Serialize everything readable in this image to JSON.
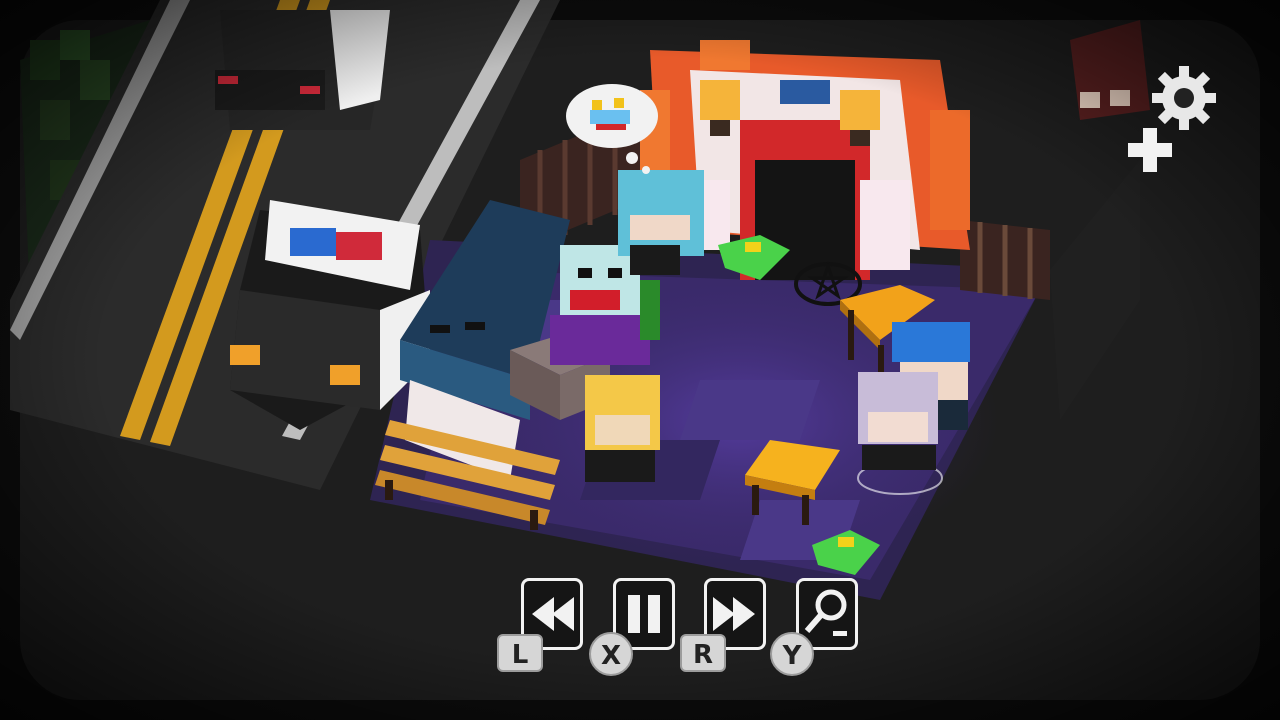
{
  "hud": {
    "controls": [
      {
        "id": "rewind",
        "icon": "rewind-icon",
        "key": "L",
        "key_shape": "square"
      },
      {
        "id": "pause",
        "icon": "pause-icon",
        "key": "X",
        "key_shape": "round"
      },
      {
        "id": "fast-forward",
        "icon": "fast-forward-icon",
        "key": "R",
        "key_shape": "square"
      },
      {
        "id": "zoom-out",
        "icon": "zoom-out-icon",
        "key": "Y",
        "key_shape": "round"
      }
    ],
    "settings_icon": "gear-icon",
    "add_icon": "plus-icon"
  },
  "scene": {
    "theme": "carnival night crime scene",
    "thought_bubble_icon": "roller-coaster-icon",
    "colors": {
      "floor": "#3a2a6a",
      "road": "#2a2a2a",
      "road_line": "#e2a620",
      "bg": "#0c0c0c",
      "accent_red": "#e23a2a",
      "accent_orange": "#f07830",
      "police_blue": "#2a6ad0",
      "police_red": "#d02a3a",
      "cash_green": "#4ad24a",
      "table_orange": "#f2a21a"
    }
  }
}
